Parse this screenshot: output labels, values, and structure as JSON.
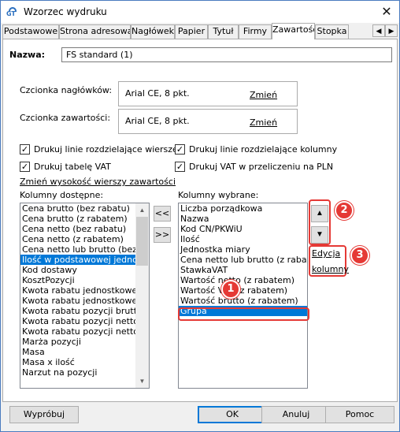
{
  "window": {
    "title": "Wzorzec wydruku",
    "close": "✕"
  },
  "tabs": [
    "Podstawowe",
    "Strona adresowa",
    "Nagłówek",
    "Papier",
    "Tytuł",
    "Firmy",
    "Zawartość",
    "Stopka"
  ],
  "active_tab": "Zawartość",
  "tab_scroll": {
    "left": "◀",
    "right": "▶"
  },
  "name": {
    "label": "Nazwa:",
    "value": "FS standard (1)"
  },
  "header_font": {
    "label": "Czcionka nagłówków:",
    "value": "Arial CE, 8 pkt.",
    "change": "Zmień"
  },
  "content_font": {
    "label": "Czcionka zawartości:",
    "value": "Arial CE, 8 pkt.",
    "change": "Zmień"
  },
  "checkboxes": {
    "row_lines": {
      "label": "Drukuj linie rozdzielające wiersze",
      "checked": "✓"
    },
    "col_lines": {
      "label": "Drukuj linie rozdzielające kolumny",
      "checked": "✓"
    },
    "vat_table": {
      "label": "Drukuj tabelę VAT",
      "checked": "✓"
    },
    "vat_pln": {
      "label": "Drukuj VAT w przeliczeniu na PLN",
      "checked": "✓"
    }
  },
  "row_height_link": "Zmień wysokość wierszy zawartości",
  "available": {
    "label": "Kolumny dostępne:",
    "items": [
      "Cena brutto (bez rabatu)",
      "Cena brutto (z rabatem)",
      "Cena netto (bez rabatu)",
      "Cena netto (z rabatem)",
      "Cena netto lub brutto (bez rab",
      "Ilość w podstawowej jednostce",
      "Kod dostawy",
      "KosztPozycji",
      "Kwota rabatu jednostkowego",
      "Kwota rabatu jednostkowego",
      "Kwota rabatu pozycji brutto",
      "Kwota rabatu pozycji netto",
      "Kwota rabatu pozycji netto lu",
      "Marża pozycji",
      "Masa",
      "Masa x ilość",
      "Narzut na pozycji"
    ],
    "selected_index": 5
  },
  "move_buttons": {
    "add": "<<",
    "remove": ">>"
  },
  "chosen": {
    "label": "Kolumny wybrane:",
    "items": [
      "Liczba porządkowa",
      "Nazwa",
      "Kod CN/PKWiU",
      "Ilość",
      "Jednostka miary",
      "Cena netto lub brutto (z rabatem)",
      "StawkaVAT",
      "Wartość netto (z rabatem)",
      "Wartość VAT (z rabatem)",
      "Wartość brutto (z rabatem)",
      "Grupa"
    ],
    "selected_index": 10
  },
  "order": {
    "up": "▲",
    "down": "▼"
  },
  "edit_column": {
    "line1": "Edycja",
    "line2": "kolumny"
  },
  "badges": [
    "1",
    "2",
    "3"
  ],
  "buttons": {
    "preview": "Wypróbuj",
    "ok": "OK",
    "cancel": "Anuluj",
    "help": "Pomoc"
  },
  "colors": {
    "accent": "#0078d7",
    "annotation": "#e53935"
  }
}
